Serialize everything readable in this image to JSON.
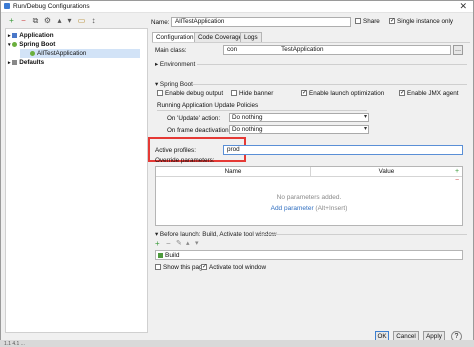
{
  "window": {
    "title": "Run/Debug Configurations"
  },
  "toolbar": {
    "icons": [
      "add-icon",
      "remove-icon",
      "copy-icon",
      "settings-icon",
      "move-up-icon",
      "move-down-icon",
      "folder-icon",
      "sort-icon"
    ]
  },
  "tree": {
    "items": [
      {
        "label": "Application",
        "bold": true
      },
      {
        "label": "Spring Boot",
        "bold": true
      },
      {
        "label": "AllTestApplication",
        "selected": true
      },
      {
        "label": "Defaults",
        "bold": true
      }
    ]
  },
  "header": {
    "name_label": "Name:",
    "name_value": "AllTestApplication",
    "share_label": "Share",
    "single_instance_label": "Single instance only"
  },
  "tabs": [
    "Configuration",
    "Code Coverage",
    "Logs"
  ],
  "config": {
    "main_class_label": "Main class:",
    "main_class_value_start": "con",
    "main_class_value_end": "TestApplication",
    "environment_label": "Environment",
    "spring_boot_label": "Spring Boot",
    "enable_debug_label": "Enable debug output",
    "hide_banner_label": "Hide banner",
    "enable_launch_label": "Enable launch optimization",
    "enable_jmx_label": "Enable JMX agent",
    "update_policies_label": "Running Application Update Policies",
    "on_update_label": "On 'Update' action:",
    "on_update_value": "Do nothing",
    "on_frame_label": "On frame deactivation:",
    "on_frame_value": "Do nothing",
    "active_profiles_label": "Active profiles:",
    "active_profiles_value": "prod",
    "override_label": "Override parameters:",
    "col_name": "Name",
    "col_value": "Value",
    "no_params": "No parameters added.",
    "add_param": "Add parameter",
    "add_param_hint": "(Alt+Insert)"
  },
  "before_launch": {
    "label": "Before launch: Build, Activate tool window",
    "build_item": "Build",
    "show_page_label": "Show this page",
    "activate_label": "Activate tool window"
  },
  "buttons": {
    "ok": "OK",
    "cancel": "Cancel",
    "apply": "Apply"
  },
  "taskbar": {
    "text": "1.1 4.1 ..."
  }
}
